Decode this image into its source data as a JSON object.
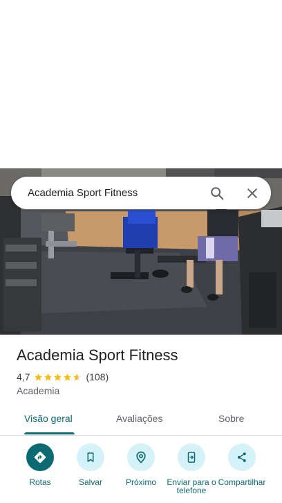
{
  "search": {
    "query": "Academia Sport Fitness"
  },
  "place": {
    "name": "Academia Sport Fitness",
    "rating": "4,7",
    "stars": 4.7,
    "review_count": "(108)",
    "category": "Academia"
  },
  "tabs": [
    {
      "label": "Visão geral",
      "active": true
    },
    {
      "label": "Avaliações",
      "active": false
    },
    {
      "label": "Sobre",
      "active": false
    }
  ],
  "actions": [
    {
      "label": "Rotas",
      "icon": "directions-icon"
    },
    {
      "label": "Salvar",
      "icon": "bookmark-icon"
    },
    {
      "label": "Próximo",
      "icon": "nearby-icon"
    },
    {
      "label": "Enviar para o telefone",
      "icon": "send-to-phone-icon"
    },
    {
      "label": "Compartilhar",
      "icon": "share-icon"
    }
  ],
  "colors": {
    "accent": "#0b6a72",
    "accent_light": "#d4f2f7",
    "star": "#fbbc04"
  }
}
